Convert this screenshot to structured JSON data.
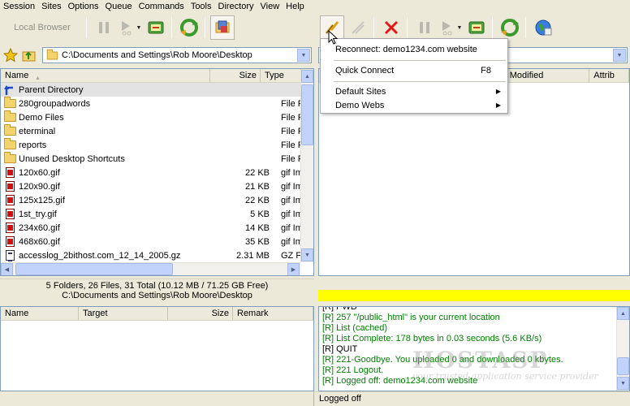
{
  "menubar": [
    "Session",
    "Sites",
    "Options",
    "Queue",
    "Commands",
    "Tools",
    "Directory",
    "View",
    "Help"
  ],
  "left_toolbar": {
    "local_browser_label": "Local Browser"
  },
  "left_path": "C:\\Documents and Settings\\Rob Moore\\Desktop",
  "left_columns": {
    "name": "Name",
    "size": "Size",
    "type": "Type"
  },
  "left_files": [
    {
      "name": "Parent Directory",
      "size": "",
      "type": "",
      "icon": "parent-dir-icon"
    },
    {
      "name": "280groupadwords",
      "size": "",
      "type": "File Folder",
      "icon": "folder-icon"
    },
    {
      "name": "Demo Files",
      "size": "",
      "type": "File Folder",
      "icon": "folder-icon"
    },
    {
      "name": "eterminal",
      "size": "",
      "type": "File Folder",
      "icon": "folder-icon"
    },
    {
      "name": "reports",
      "size": "",
      "type": "File Folder",
      "icon": "folder-icon"
    },
    {
      "name": "Unused Desktop Shortcuts",
      "size": "",
      "type": "File Folder",
      "icon": "folder-icon"
    },
    {
      "name": "120x60.gif",
      "size": "22 KB",
      "type": "gif Image",
      "icon": "gif-file-icon"
    },
    {
      "name": "120x90.gif",
      "size": "21 KB",
      "type": "gif Image",
      "icon": "gif-file-icon"
    },
    {
      "name": "125x125.gif",
      "size": "22 KB",
      "type": "gif Image",
      "icon": "gif-file-icon"
    },
    {
      "name": "1st_try.gif",
      "size": "5 KB",
      "type": "gif Image",
      "icon": "gif-file-icon"
    },
    {
      "name": "234x60.gif",
      "size": "14 KB",
      "type": "gif Image",
      "icon": "gif-file-icon"
    },
    {
      "name": "468x60.gif",
      "size": "35 KB",
      "type": "gif Image",
      "icon": "gif-file-icon"
    },
    {
      "name": "accesslog_2bithost.com_12_14_2005.gz",
      "size": "2.31 MB",
      "type": "GZ File",
      "icon": "gz-file-icon"
    }
  ],
  "left_status": {
    "summary": "5 Folders, 26 Files, 31 Total (10.12 MB / 71.25 GB Free)",
    "path": "C:\\Documents and Settings\\Rob Moore\\Desktop"
  },
  "right_columns": {
    "modified": "Modified",
    "attrib": "Attrib"
  },
  "queue_columns": {
    "name": "Name",
    "target": "Target",
    "size": "Size",
    "remark": "Remark"
  },
  "connect_menu": {
    "reconnect": "Reconnect: demo1234.com website",
    "quick_connect": "Quick Connect",
    "quick_connect_shortcut": "F8",
    "default_sites": "Default Sites",
    "demo_webs": "Demo Webs"
  },
  "log": [
    {
      "text": "[R] PWD",
      "color": "black"
    },
    {
      "text": "[R] 257 \"/public_html\" is your current location",
      "color": "green"
    },
    {
      "text": "[R] List (cached)",
      "color": "green"
    },
    {
      "text": "[R] List Complete: 178 bytes in 0.03 seconds (5.6 KB/s)",
      "color": "green"
    },
    {
      "text": "[R] QUIT",
      "color": "black"
    },
    {
      "text": "[R] 221-Goodbye. You uploaded 0 and downloaded 0 kbytes.",
      "color": "green"
    },
    {
      "text": "[R] 221 Logout.",
      "color": "green"
    },
    {
      "text": "[R] Logged off: demo1234.com website",
      "color": "green"
    }
  ],
  "bottom_status": "Logged off",
  "watermark": {
    "big": "HOSTASP",
    "small": "your trusted application service provider"
  },
  "colors": {
    "progress": "#ffff00",
    "log_green": "#008000"
  }
}
